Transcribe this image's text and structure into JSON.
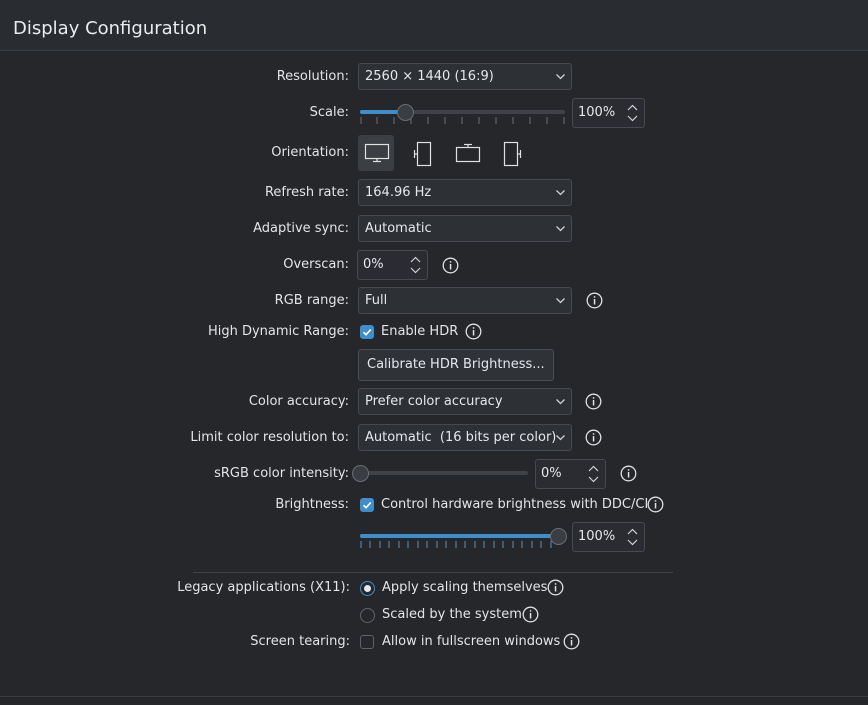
{
  "header": {
    "title": "Display Configuration"
  },
  "form": {
    "resolution": {
      "label": "Resolution:",
      "value": "2560 × 1440 (16:9)"
    },
    "scale": {
      "label": "Scale:",
      "value": "100%",
      "slider_fraction": 0.22
    },
    "orientation": {
      "label": "Orientation:",
      "options": [
        "landscape",
        "portrait",
        "landscape-flipped",
        "portrait-flipped"
      ],
      "selected": "landscape"
    },
    "refresh_rate": {
      "label": "Refresh rate:",
      "value": "164.96 Hz"
    },
    "adaptive_sync": {
      "label": "Adaptive sync:",
      "value": "Automatic"
    },
    "overscan": {
      "label": "Overscan:",
      "value": "0%"
    },
    "rgb_range": {
      "label": "RGB range:",
      "value": "Full"
    },
    "hdr": {
      "label": "High Dynamic Range:",
      "checkbox_label": "Enable HDR",
      "checked": true,
      "calibrate_button": "Calibrate HDR Brightness..."
    },
    "color_accuracy": {
      "label": "Color accuracy:",
      "value": "Prefer color accuracy"
    },
    "color_resolution": {
      "label": "Limit color resolution to:",
      "value": "Automatic  (16 bits per color)"
    },
    "srgb_intensity": {
      "label": "sRGB color intensity:",
      "value": "0%",
      "slider_fraction": 0.0
    },
    "brightness": {
      "label": "Brightness:",
      "checkbox_label": "Control hardware brightness with DDC/CI",
      "checked": true,
      "value": "100%",
      "slider_fraction": 1.0
    },
    "legacy_apps": {
      "label": "Legacy applications (X11):",
      "options": [
        "Apply scaling themselves",
        "Scaled by the system"
      ],
      "selected": 0
    },
    "screen_tearing": {
      "label": "Screen tearing:",
      "checkbox_label": "Allow in fullscreen windows",
      "checked": false
    }
  },
  "colors": {
    "accent": "#3f8ecb",
    "background": "#25272b",
    "text": "#e6e7e9"
  },
  "icons": {
    "info": "info-icon",
    "chevron": "chevron-down-icon",
    "spin": "spin-arrows-icon",
    "check": "check-icon"
  }
}
